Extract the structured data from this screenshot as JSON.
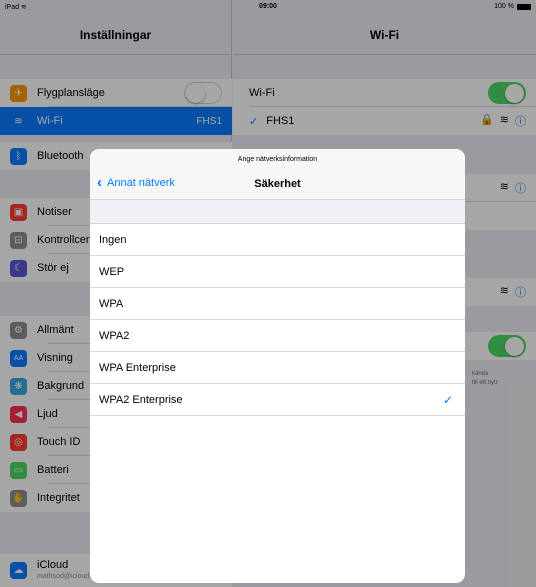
{
  "statusbar": {
    "device": "iPad",
    "time": "09:00",
    "battery": "100 %"
  },
  "master": {
    "title": "Inställningar",
    "items": [
      {
        "label": "Flygplansläge",
        "color": "#ff9500"
      },
      {
        "label": "Wi-Fi",
        "value": "FHS1",
        "color": "#0a7aff"
      },
      {
        "label": "Bluetooth",
        "color": "#0a7aff"
      },
      {
        "label": "Notiser",
        "color": "#ff3b30"
      },
      {
        "label": "Kontrollcenter",
        "color": "#8e8e93"
      },
      {
        "label": "Stör ej",
        "color": "#5856d6"
      },
      {
        "label": "Allmänt",
        "color": "#8e8e93"
      },
      {
        "label": "Visning",
        "color": "#0a7aff"
      },
      {
        "label": "Bakgrund",
        "color": "#34aadc"
      },
      {
        "label": "Ljud",
        "color": "#ff2d55"
      },
      {
        "label": "Touch ID",
        "color": "#ff3b30"
      },
      {
        "label": "Batteri",
        "color": "#4cd964"
      },
      {
        "label": "Integritet",
        "color": "#8e8e93"
      },
      {
        "label": "iCloud",
        "sublabel": "mathsod@icloud.com",
        "color": "#0a7aff"
      }
    ]
  },
  "detail": {
    "title": "Wi-Fi",
    "wifi_label": "Wi-Fi",
    "network": "FHS1",
    "ask_text_1": "kända",
    "ask_text_2": "till ett nytt"
  },
  "modal": {
    "prompt": "Ange nätverksinformation",
    "back_label": "Annat nätverk",
    "title": "Säkerhet",
    "options": [
      "Ingen",
      "WEP",
      "WPA",
      "WPA2",
      "WPA Enterprise",
      "WPA2 Enterprise"
    ],
    "selected_index": 5
  }
}
